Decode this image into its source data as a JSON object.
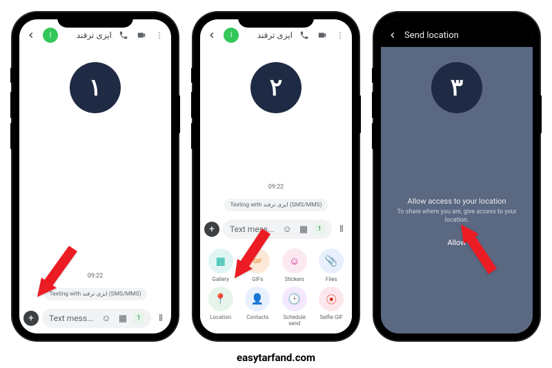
{
  "attribution": "easytarfand.com",
  "phone1": {
    "step": "۱",
    "contact_initial": "ا",
    "contact_name": "ایزی ترفند",
    "timestamp": "09:22",
    "info_chip": "Texting with ایزی ترفند (SMS/MMS)",
    "input_placeholder": "Text mess...",
    "sim": "1"
  },
  "phone2": {
    "step": "۲",
    "contact_initial": "ا",
    "contact_name": "ایزی ترفند",
    "timestamp": "09:22",
    "info_chip": "Texting with ایزی ترفند (SMS/MMS)",
    "input_placeholder": "Text mess...",
    "sim": "1",
    "attachments": [
      {
        "label": "Gallery",
        "glyph": "▦",
        "cls": "c-teal"
      },
      {
        "label": "GIFs",
        "glyph": "GIF",
        "cls": "c-orange"
      },
      {
        "label": "Stickers",
        "glyph": "☺",
        "cls": "c-pink"
      },
      {
        "label": "Files",
        "glyph": "📎",
        "cls": "c-blue"
      },
      {
        "label": "Location",
        "glyph": "📍",
        "cls": "c-green"
      },
      {
        "label": "Contacts",
        "glyph": "👤",
        "cls": "c-lblue"
      },
      {
        "label": "Schedule send",
        "glyph": "🕒",
        "cls": "c-purple"
      },
      {
        "label": "Selfie GIF",
        "glyph": "⦿",
        "cls": "c-rose"
      }
    ]
  },
  "phone3": {
    "step": "۳",
    "title": "Send location",
    "perm_title": "Allow access to your location",
    "perm_sub": "To share where you are, give access to your location.",
    "allow": "Allow"
  }
}
